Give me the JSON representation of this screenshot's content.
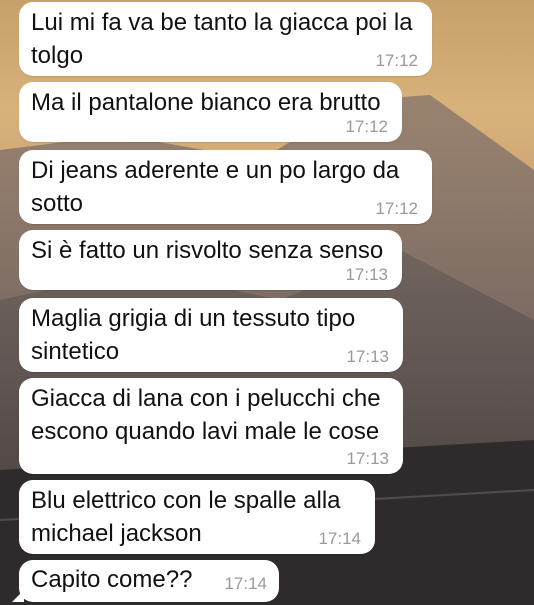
{
  "messages": [
    {
      "lines": [
        "Lui mi fa va be tanto la giacca poi la",
        "tolgo"
      ],
      "time": "17:12"
    },
    {
      "lines": [
        "Ma il pantalone bianco era brutto"
      ],
      "time": "17:12"
    },
    {
      "lines": [
        "Di jeans aderente e un po largo da",
        "sotto"
      ],
      "time": "17:12"
    },
    {
      "lines": [
        "Si è fatto un risvolto senza senso"
      ],
      "time": "17:13"
    },
    {
      "lines": [
        "Maglia grigia di un tessuto tipo",
        "sintetico"
      ],
      "time": "17:13"
    },
    {
      "lines": [
        "Giacca di lana con i pelucchi che",
        "escono quando lavi male le cose"
      ],
      "time": "17:13"
    },
    {
      "lines": [
        "Blu elettrico con le spalle alla",
        "michael jackson"
      ],
      "time": "17:14"
    },
    {
      "lines": [
        "Capito come??"
      ],
      "time": "17:14"
    }
  ]
}
